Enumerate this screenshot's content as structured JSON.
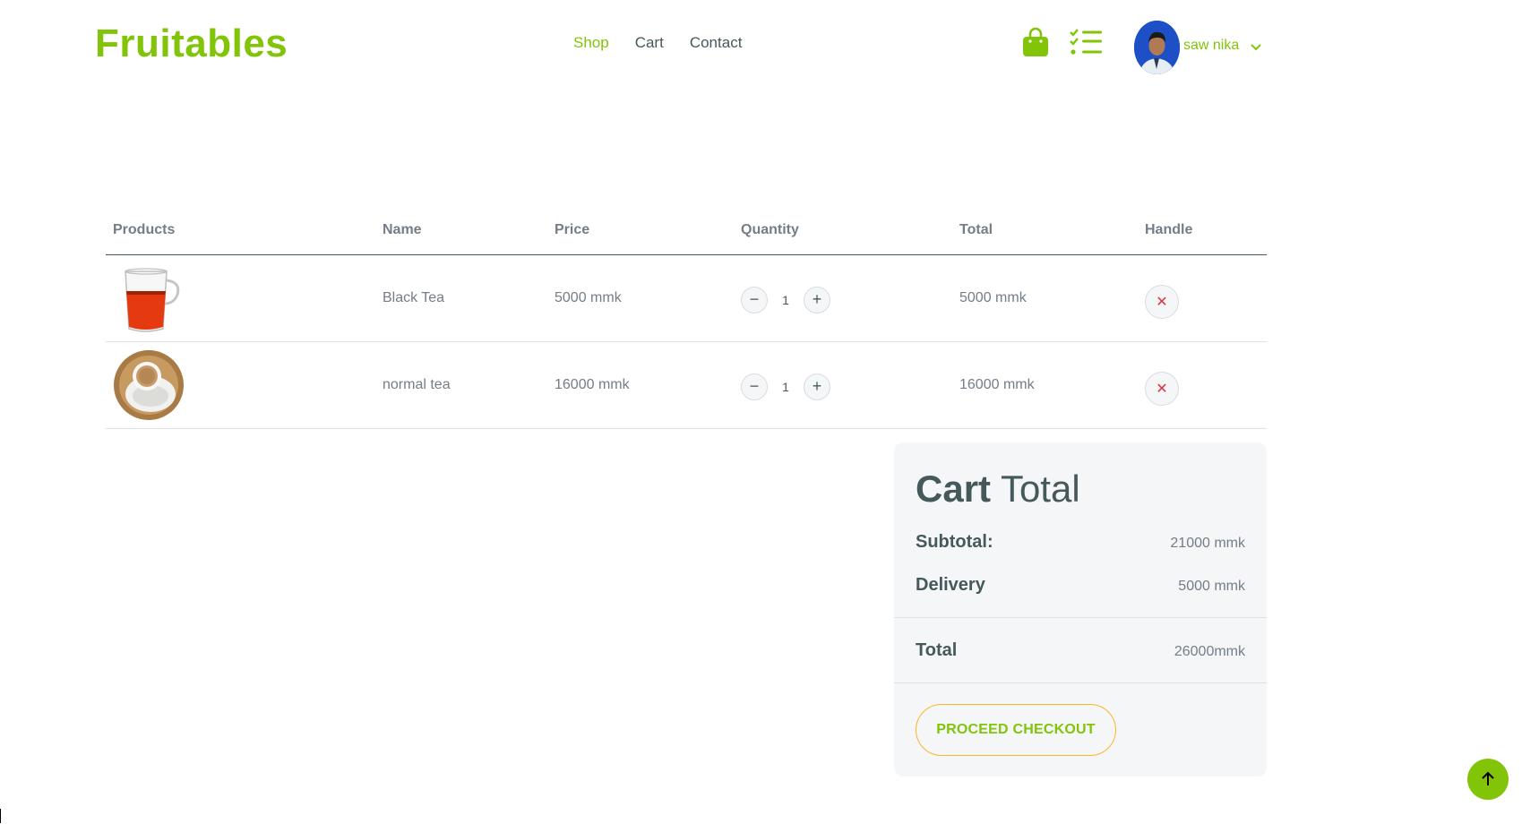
{
  "brand": "Fruitables",
  "nav": {
    "shop": "Shop",
    "cart": "Cart",
    "contact": "Contact"
  },
  "user": {
    "name": "saw nika"
  },
  "icons": {
    "bag": "shopping-bag-icon",
    "list": "checklist-icon",
    "chevron": "chevron-down-icon",
    "minus": "minus-icon",
    "plus": "plus-icon",
    "remove": "close-icon",
    "back_top": "arrow-up-icon"
  },
  "colors": {
    "brand": "#81c408",
    "accent": "#ffb524",
    "danger": "#dc3545",
    "text": "#45595b",
    "muted": "#747d88"
  },
  "table": {
    "headers": {
      "products": "Products",
      "name": "Name",
      "price": "Price",
      "quantity": "Quantity",
      "total": "Total",
      "handle": "Handle"
    },
    "rows": [
      {
        "name": "Black Tea",
        "price": "5000 mmk",
        "quantity": "1",
        "total": "5000 mmk"
      },
      {
        "name": "normal tea",
        "price": "16000 mmk",
        "quantity": "1",
        "total": "16000 mmk"
      }
    ]
  },
  "summary": {
    "title_bold": "Cart",
    "title_rest": "Total",
    "subtotal_label": "Subtotal:",
    "subtotal_value": "21000 mmk",
    "delivery_label": "Delivery",
    "delivery_value": "5000 mmk",
    "total_label": "Total",
    "total_value": "26000mmk",
    "checkout_label": "PROCEED CHECKOUT"
  }
}
